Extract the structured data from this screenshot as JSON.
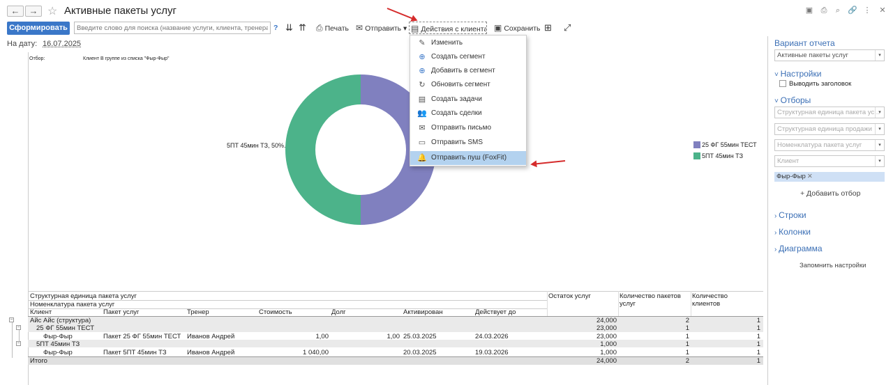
{
  "window": {
    "title": "Активные пакеты услуг"
  },
  "toolbar": {
    "generate_label": "Сформировать",
    "search_placeholder": "Введите слово для поиска (название услуги, клиента, тренера, п",
    "help_label": "?",
    "print_label": "Печать",
    "send_label": "Отправить",
    "actions_label": "Действия с клиентами",
    "save_label": "Сохранить"
  },
  "date": {
    "label": "На дату:",
    "value": "16.07.2025"
  },
  "filter": {
    "label": "Отбор:",
    "value": "Клиент В группе из списка \"Фыр-Фыр\""
  },
  "actions_menu": {
    "items": [
      {
        "label": "Изменить",
        "icon": "pencil-icon"
      },
      {
        "label": "Создать сегмент",
        "icon": "plus-circle-icon"
      },
      {
        "label": "Добавить в сегмент",
        "icon": "plus-circle-icon"
      },
      {
        "label": "Обновить сегмент",
        "icon": "refresh-icon"
      },
      {
        "label": "Создать задачи",
        "icon": "task-card-icon"
      },
      {
        "label": "Создать сделки",
        "icon": "users-icon"
      },
      {
        "label": "Отправить письмо",
        "icon": "envelope-icon"
      },
      {
        "label": "Отправить SMS",
        "icon": "sms-icon"
      },
      {
        "label": "Отправить пуш (FoxFit)",
        "icon": "bell-icon"
      }
    ],
    "selected_index": 8
  },
  "chart_data": {
    "type": "pie",
    "categories": [
      "25 ФГ 55мин ТЕСТ",
      "5ПТ 45мин ТЗ"
    ],
    "values": [
      50,
      50
    ],
    "colors": [
      "#8080bf",
      "#4cb38a"
    ],
    "data_label": "5ПТ 45мин ТЗ, 50%.",
    "legend_position": "right"
  },
  "table": {
    "headers": {
      "group1": "Структурная единица пакета услуг",
      "group2": "Номенклатура пакета услуг",
      "client": "Клиент",
      "package": "Пакет услуг",
      "trainer": "Тренер",
      "cost": "Стоимость",
      "debt": "Долг",
      "activated": "Активирован",
      "valid_until": "Действует до",
      "remaining": "Остаток услуг",
      "packages_count": "Количество пакетов услуг",
      "clients_count": "Количество клиентов"
    },
    "rows": [
      {
        "name": "Айс Айс (структура)",
        "remaining": "24,000",
        "packages": "2",
        "clients": "1"
      },
      {
        "name": "25 ФГ 55мин ТЕСТ",
        "remaining": "23,000",
        "packages": "1",
        "clients": "1"
      },
      {
        "name": "Фыр-Фыр",
        "package": "Пакет 25 ФГ 55мин ТЕСТ",
        "trainer": "Иванов Андрей",
        "cost": "1,00",
        "debt": "1,00",
        "activated": "25.03.2025",
        "valid_until": "24.03.2026",
        "remaining": "23,000",
        "packages": "1",
        "clients": "1"
      },
      {
        "name": "5ПТ 45мин ТЗ",
        "remaining": "1,000",
        "packages": "1",
        "clients": "1"
      },
      {
        "name": "Фыр-Фыр",
        "package": "Пакет 5ПТ 45мин ТЗ",
        "trainer": "Иванов Андрей",
        "cost": "1 040,00",
        "debt": "",
        "activated": "20.03.2025",
        "valid_until": "19.03.2026",
        "remaining": "1,000",
        "packages": "1",
        "clients": "1"
      }
    ],
    "total": {
      "label": "Итого",
      "remaining": "24,000",
      "packages": "2",
      "clients": "1"
    }
  },
  "side_panel": {
    "variant_label": "Вариант отчета",
    "variant_value": "Активные пакеты услуг",
    "settings_label": "Настройки",
    "show_header_label": "Выводить заголовок",
    "filters_label": "Отборы",
    "filter_fields": [
      "Структурная единица пакета ус...",
      "Структурная единица продажи",
      "Номенклатура пакета услуг",
      "Клиент"
    ],
    "tag": "Фыр-Фыр",
    "add_filter": "+ Добавить отбор",
    "rows_label": "Строки",
    "columns_label": "Колонки",
    "diagram_label": "Диаграмма",
    "remember_label": "Запомнить настройки"
  }
}
